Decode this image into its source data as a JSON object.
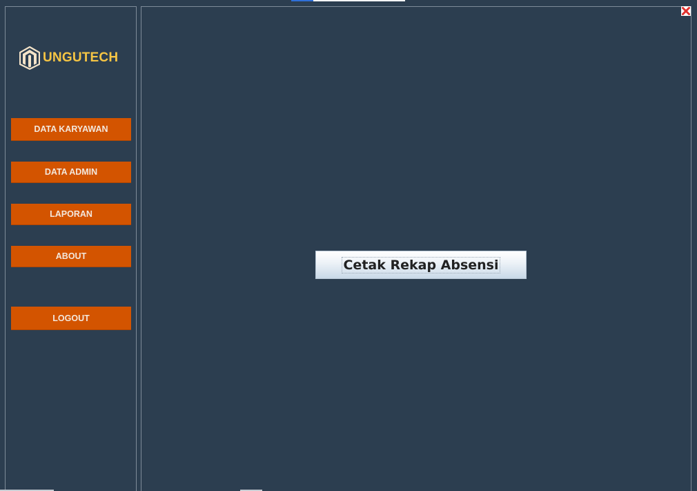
{
  "brand": {
    "name": "UNGUTECH",
    "logo_icon": "magento-style-logo-icon",
    "text_color": "#f6c544"
  },
  "sidebar": {
    "items": [
      {
        "label": "DATA KARYAWAN"
      },
      {
        "label": "DATA ADMIN"
      },
      {
        "label": "LAPORAN"
      },
      {
        "label": "ABOUT"
      },
      {
        "label": "LOGOUT"
      }
    ],
    "button_color": "#d35400"
  },
  "main": {
    "print_button_label": "Cetak Rekap Absensi"
  },
  "window": {
    "close_icon": "close-icon",
    "background": "#2c3e50"
  }
}
